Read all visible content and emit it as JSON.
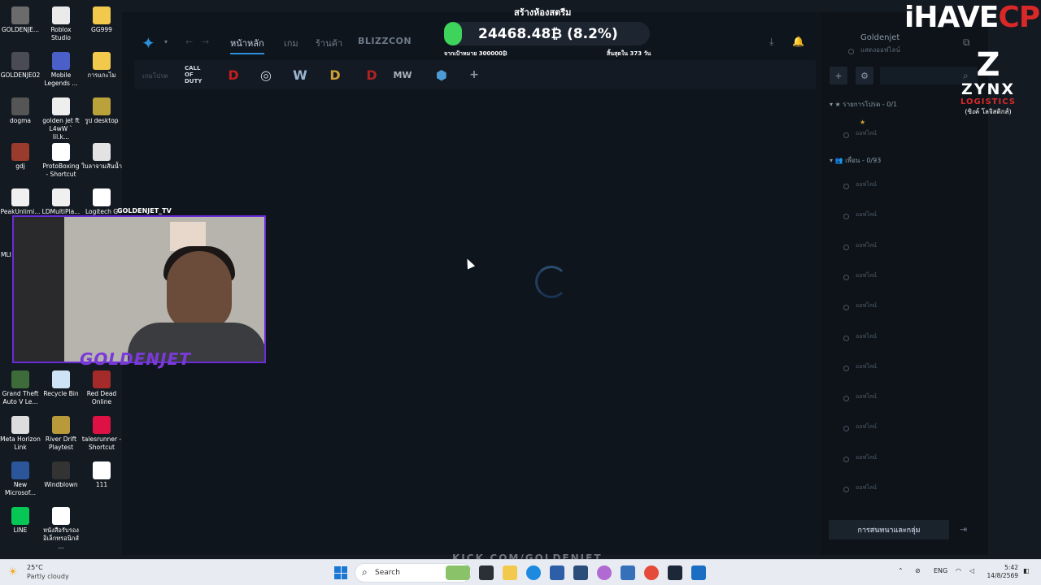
{
  "desktop": {
    "icons": [
      {
        "label": "GOLDENJE...",
        "color": "#6b6b6b"
      },
      {
        "label": "Roblox Studio",
        "color": "#eaeaea"
      },
      {
        "label": "GG999",
        "color": "#f2c94c"
      },
      {
        "label": "GOLDENJE02",
        "color": "#4b4b55"
      },
      {
        "label": "Mobile Legends ...",
        "color": "#4a60c8"
      },
      {
        "label": "การแกะไม",
        "color": "#f2c94c"
      },
      {
        "label": "dogma",
        "color": "#555"
      },
      {
        "label": "golden jet ft L4wW ` lil.k...",
        "color": "#eee"
      },
      {
        "label": "รูป desktop",
        "color": "#b9a23a"
      },
      {
        "label": "gdj",
        "color": "#9a3b2d"
      },
      {
        "label": "ProtoBoxing - Shortcut",
        "color": "#fff"
      },
      {
        "label": "ใบลาจามสันน้ำ",
        "color": "#e3e3e3"
      },
      {
        "label": "PeakUnlimi...",
        "color": "#f0f0f0"
      },
      {
        "label": "LDMultiPla...",
        "color": "#f0f0f0"
      },
      {
        "label": "Logitech G HUB",
        "color": "#fff"
      },
      {
        "label": "Grand Theft Auto V Le...",
        "color": "#3d6b3a"
      },
      {
        "label": "Recycle Bin",
        "color": "#cfe3f7"
      },
      {
        "label": "Red Dead Online",
        "color": "#a52a2a"
      },
      {
        "label": "Meta Horizon Link",
        "color": "#ddd"
      },
      {
        "label": "River Drift Playtest",
        "color": "#b89a3a"
      },
      {
        "label": "talesrunner - Shortcut",
        "color": "#d14"
      },
      {
        "label": "New Microsof...",
        "color": "#2b579a"
      },
      {
        "label": "Windblown",
        "color": "#333"
      },
      {
        "label": "111",
        "color": "#fff"
      },
      {
        "label": "LINE",
        "color": "#06c755"
      },
      {
        "label": "หนังสือรับรอง อิเล็กทรอนิกส์ ...",
        "color": "#fff"
      }
    ],
    "partial_label_mli": "MLI"
  },
  "bnet": {
    "nav": {
      "home": "หน้าหลัก",
      "games": "เกม",
      "shop": "ร้านค้า",
      "blizzcon": "BLIZZCON"
    },
    "gamebar_label": "เกมโปรด",
    "games": [
      {
        "name": "call-of-duty",
        "text": "CALL OF DUTY",
        "color": "#cfd6de"
      },
      {
        "name": "diablo",
        "text": "D",
        "color": "#c41e1e"
      },
      {
        "name": "overwatch",
        "text": "◎",
        "color": "#d0d7de"
      },
      {
        "name": "warcraft",
        "text": "W",
        "color": "#9bb5d1"
      },
      {
        "name": "diablo-2",
        "text": "D",
        "color": "#d0a234"
      },
      {
        "name": "diablo-immortal",
        "text": "D",
        "color": "#b02222"
      },
      {
        "name": "mw",
        "text": "MW",
        "color": "#a9b1bb"
      },
      {
        "name": "heroes",
        "text": "⬢",
        "color": "#4c9bd6"
      }
    ],
    "add_game": "+"
  },
  "friends": {
    "username": "Goldenjet",
    "status": "แสดงออฟไลน์",
    "favorites_header": "รายการโปรด - 0/1",
    "friends_header": "เพื่อน - 0/93",
    "offline": "ออฟไลน์",
    "favorite_items": 1,
    "friend_items": 11,
    "bottom_button": "การสนทนาและกลุ่ม"
  },
  "overlay": {
    "banner": "สร้างห้องสตรีม",
    "counter_value": "24468.48₿ (8.2%)",
    "counter_left": "จากเป้าหมาย 300000₿",
    "counter_right": "สิ้นสุดใน 373 วัน",
    "brand_left": "iHAVE",
    "brand_right": "CPU",
    "zynx_z": "Z",
    "zynx_name": "ZYNX",
    "zynx_sub": "LOGISTICS",
    "zynx_th": "(ซิงค์ โลจิสติกส์)",
    "webcam_tag": "GOLDENJET_TV",
    "webcam_logo": "GOLDENJET",
    "kick": "KICK.COM/GOLDENJET"
  },
  "taskbar": {
    "weather_temp": "25°C",
    "weather_desc": "Partly cloudy",
    "search_placeholder": "Search",
    "lang": "ENG",
    "time": "5:42",
    "date": "14/8/2569"
  }
}
